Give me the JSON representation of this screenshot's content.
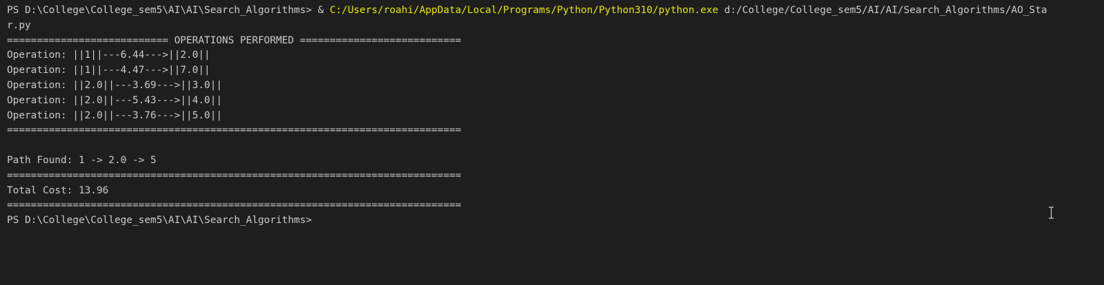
{
  "terminal": {
    "command_line": {
      "prompt": "PS D:\\College\\College_sem5\\AI\\AI\\Search_Algorithms> & ",
      "python_exe": "C:/Users/roahi/AppData/Local/Programs/Python/Python310/python.exe",
      "script_path_part1": " d:/College/College_sem5/AI/AI/Search_Algorithms/AO_Sta",
      "script_path_part2": "r.py"
    },
    "header": "=========================== OPERATIONS PERFORMED ===========================",
    "operations": [
      "Operation: ||1||---6.44--->||2.0||",
      "Operation: ||1||---4.47--->||7.0||",
      "Operation: ||2.0||---3.69--->||3.0||",
      "Operation: ||2.0||---5.43--->||4.0||",
      "Operation: ||2.0||---3.76--->||5.0||"
    ],
    "separator": "============================================================================",
    "path_found": "Path Found: 1 -> 2.0 -> 5",
    "total_cost": "Total Cost: 13.96",
    "final_prompt": "PS D:\\College\\College_sem5\\AI\\AI\\Search_Algorithms>"
  },
  "colors": {
    "background": "#1e1e1e",
    "text": "#cccccc",
    "highlight": "#e5e510"
  },
  "icons": {
    "mouse_cursor": "text-ibeam-cursor"
  }
}
